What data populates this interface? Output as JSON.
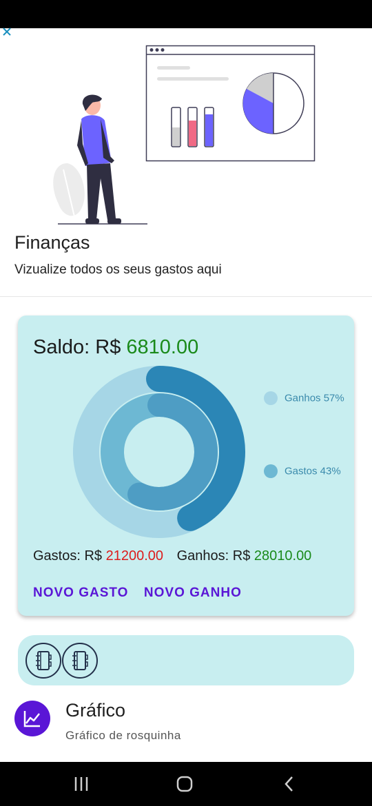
{
  "hero": {
    "title": "Finanças",
    "subtitle": "Vizualize todos os seus gastos aqui"
  },
  "summary": {
    "saldo_label": "Saldo: R$",
    "saldo_value": "6810.00",
    "gastos_label": "Gastos: R$",
    "gastos_value": "21200.00",
    "ganhos_label": "Ganhos: R$",
    "ganhos_value": "28010.00"
  },
  "legend": [
    {
      "label": "Ganhos 57%",
      "color": "#a6d6e6"
    },
    {
      "label": "Gastos 43%",
      "color": "#6db8d3"
    }
  ],
  "donut": {
    "outer_share": 0.43,
    "inner_share": 0.57,
    "colors": {
      "outer_track": "#a6d6e6",
      "outer_fill": "#2b86b6",
      "inner_track": "#6db8d3",
      "inner_fill": "#4e9dc4"
    }
  },
  "actions": {
    "novo_gasto": "NOVO GASTO",
    "novo_ganho": "NOVO GANHO"
  },
  "list": {
    "title": "Gráfico",
    "subtitle": "Gráfico de rosquinha"
  },
  "colors": {
    "card_bg": "#c8eef0",
    "accent": "#5a16d6",
    "positive": "#1a8a1a",
    "negative": "#dd1c1c"
  },
  "icons": [
    "close-icon",
    "notebook-icon",
    "notebook-icon",
    "chart-line-icon",
    "recents-icon",
    "home-icon",
    "back-icon"
  ]
}
